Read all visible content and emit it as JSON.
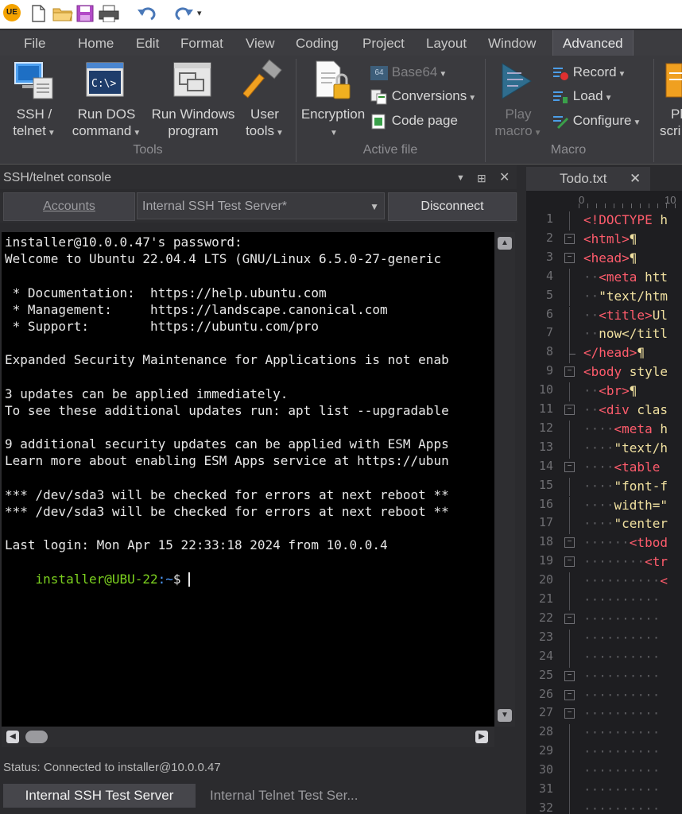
{
  "qat": {
    "logo": "UE"
  },
  "menu": {
    "items": [
      "File",
      "Home",
      "Edit",
      "Format",
      "View",
      "Coding",
      "Project",
      "Layout",
      "Window",
      "Advanced"
    ]
  },
  "ribbon": {
    "tools": {
      "ssh_l1": "SSH /",
      "ssh_l2": "telnet",
      "rundos_l1": "Run DOS",
      "rundos_l2": "command",
      "runwin_l1": "Run Windows",
      "runwin_l2": "program",
      "user_l1": "User",
      "user_l2": "tools",
      "group": "Tools"
    },
    "activefile": {
      "encryption": "Encryption",
      "base64": "Base64",
      "conversions": "Conversions",
      "codepage": "Code page",
      "group": "Active file"
    },
    "macro": {
      "play_l1": "Play",
      "play_l2": "macro",
      "record": "Record",
      "load": "Load",
      "configure": "Configure",
      "group": "Macro",
      "script_l1": "Pl",
      "script_l2": "scri"
    }
  },
  "console": {
    "title": "SSH/telnet console",
    "accounts": "Accounts",
    "server": "Internal SSH Test Server*",
    "disconnect": "Disconnect",
    "lines": [
      "installer@10.0.0.47's password:",
      "Welcome to Ubuntu 22.04.4 LTS (GNU/Linux 6.5.0-27-generic",
      "",
      " * Documentation:  https://help.ubuntu.com",
      " * Management:     https://landscape.canonical.com",
      " * Support:        https://ubuntu.com/pro",
      "",
      "Expanded Security Maintenance for Applications is not enab",
      "",
      "3 updates can be applied immediately.",
      "To see these additional updates run: apt list --upgradable",
      "",
      "9 additional security updates can be applied with ESM Apps",
      "Learn more about enabling ESM Apps service at https://ubun",
      "",
      "*** /dev/sda3 will be checked for errors at next reboot **",
      "*** /dev/sda3 will be checked for errors at next reboot **",
      "",
      "Last login: Mon Apr 15 22:33:18 2024 from 10.0.0.4"
    ],
    "prompt_user": "installer@UBU-22",
    "prompt_path": ":~",
    "prompt_symbol": "$ ",
    "status": "Status: Connected to installer@10.0.0.47",
    "tabs": [
      "Internal SSH Test Server",
      "Internal Telnet Test Ser..."
    ]
  },
  "editor": {
    "tab": "Todo.txt",
    "ruler": {
      "zero": "0",
      "ten": "10"
    },
    "line_numbers": [
      "1",
      "2",
      "3",
      "4",
      "5",
      "6",
      "7",
      "8",
      "9",
      "10",
      "11",
      "12",
      "13",
      "14",
      "15",
      "16",
      "17",
      "18",
      "19",
      "20",
      "21",
      "22",
      "23",
      "24",
      "25",
      "26",
      "27",
      "28",
      "29",
      "30",
      "31",
      "32"
    ],
    "code": [
      {
        "ws": "",
        "tag": "<!DOCTYPE",
        "txt": " h"
      },
      {
        "ws": "",
        "tag": "<html>",
        "txt": "¶"
      },
      {
        "ws": "",
        "tag": "<head>",
        "txt": "¶"
      },
      {
        "ws": "··",
        "tag": "<meta",
        "txt": " htt"
      },
      {
        "ws": "··",
        "tag": "",
        "txt": "\"text/htm"
      },
      {
        "ws": "··",
        "tag": "<title>",
        "txt": "Ul"
      },
      {
        "ws": "··",
        "tag": "",
        "txt": "now</titl"
      },
      {
        "ws": "",
        "tag": "</head>",
        "txt": "¶"
      },
      {
        "ws": "",
        "tag": "<body",
        "txt": " style"
      },
      {
        "ws": "··",
        "tag": "<br>",
        "txt": "¶"
      },
      {
        "ws": "··",
        "tag": "<div",
        "txt": " clas"
      },
      {
        "ws": "····",
        "tag": "<meta",
        "txt": " h"
      },
      {
        "ws": "····",
        "tag": "",
        "txt": "\"text/h"
      },
      {
        "ws": "····",
        "tag": "<table",
        "txt": ""
      },
      {
        "ws": "····",
        "tag": "",
        "txt": "\"font-f"
      },
      {
        "ws": "····",
        "tag": "",
        "txt": "width=\""
      },
      {
        "ws": "····",
        "tag": "",
        "txt": "\"center"
      },
      {
        "ws": "······",
        "tag": "<tbod",
        "txt": ""
      },
      {
        "ws": "········",
        "tag": "<tr",
        "txt": ""
      },
      {
        "ws": "··········",
        "tag": "<",
        "txt": ""
      },
      {
        "ws": "··········",
        "tag": "",
        "txt": ""
      },
      {
        "ws": "··········",
        "tag": "",
        "txt": ""
      },
      {
        "ws": "··········",
        "tag": "",
        "txt": ""
      },
      {
        "ws": "··········",
        "tag": "",
        "txt": ""
      },
      {
        "ws": "··········",
        "tag": "",
        "txt": ""
      },
      {
        "ws": "··········",
        "tag": "",
        "txt": ""
      },
      {
        "ws": "··········",
        "tag": "",
        "txt": ""
      },
      {
        "ws": "··········",
        "tag": "",
        "txt": ""
      },
      {
        "ws": "··········",
        "tag": "",
        "txt": ""
      },
      {
        "ws": "··········",
        "tag": "",
        "txt": ""
      },
      {
        "ws": "··········",
        "tag": "",
        "txt": ""
      },
      {
        "ws": "··········",
        "tag": "",
        "txt": ""
      }
    ]
  },
  "colors": {
    "accent": "#3a6ea5",
    "prompt_user": "#7cd11f",
    "prompt_path": "#4f9cff",
    "tag": "#ff5c6c"
  }
}
